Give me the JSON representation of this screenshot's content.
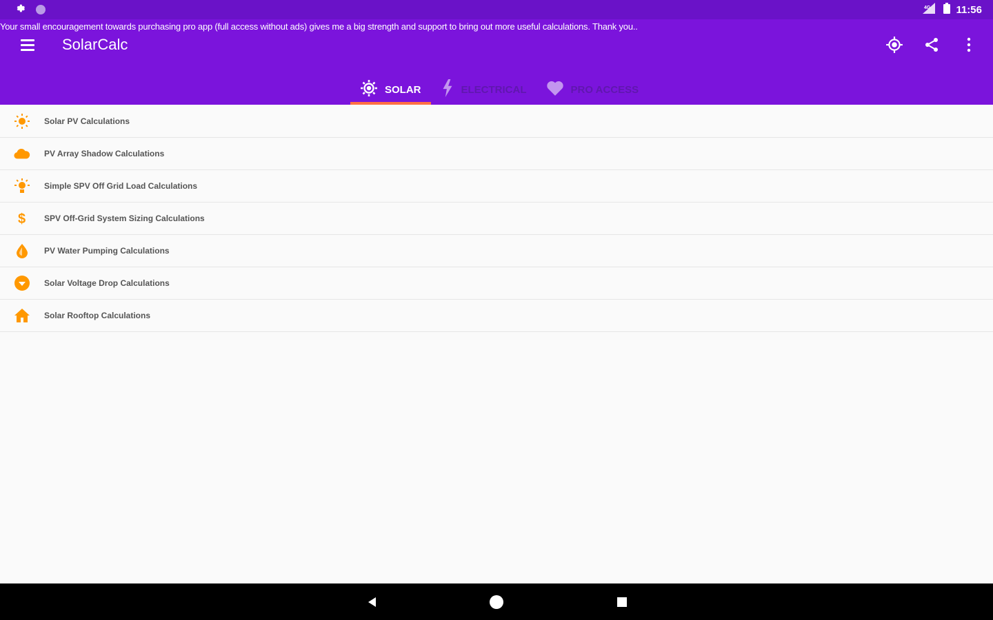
{
  "status_bar": {
    "time": "11:56",
    "icons": [
      "settings-icon",
      "circle-icon",
      "signal-icon",
      "battery-icon"
    ]
  },
  "banner": {
    "marquee_text": "Your small encouragement towards purchasing pro app (full access without ads) gives me a big strength and support to bring out more useful calculations. Thank you.."
  },
  "toolbar": {
    "title": "SolarCalc",
    "actions": [
      "gps-icon",
      "share-icon",
      "more-vert-icon"
    ]
  },
  "tabs": [
    {
      "label": "SOLAR",
      "icon": "sun-gear-icon",
      "active": true
    },
    {
      "label": "ELECTRICAL",
      "icon": "lightning-icon",
      "active": false
    },
    {
      "label": "PRO ACCESS",
      "icon": "heart-icon",
      "active": false
    }
  ],
  "list": {
    "items": [
      {
        "label": "Solar PV Calculations",
        "icon": "sun-icon"
      },
      {
        "label": "PV Array Shadow Calculations",
        "icon": "cloud-icon"
      },
      {
        "label": "Simple SPV Off Grid Load Calculations",
        "icon": "sun-load-icon"
      },
      {
        "label": "SPV Off-Grid System Sizing Calculations",
        "icon": "dollar-icon"
      },
      {
        "label": "PV Water Pumping Calculations",
        "icon": "water-drop-icon"
      },
      {
        "label": "Solar Voltage Drop Calculations",
        "icon": "voltage-drop-icon"
      },
      {
        "label": "Solar Rooftop Calculations",
        "icon": "home-icon"
      }
    ]
  },
  "colors": {
    "status_bar": "#6a12c8",
    "app_bar": "#7b14dc",
    "accent": "#ff9800",
    "tab_indicator": "#ff7043"
  }
}
